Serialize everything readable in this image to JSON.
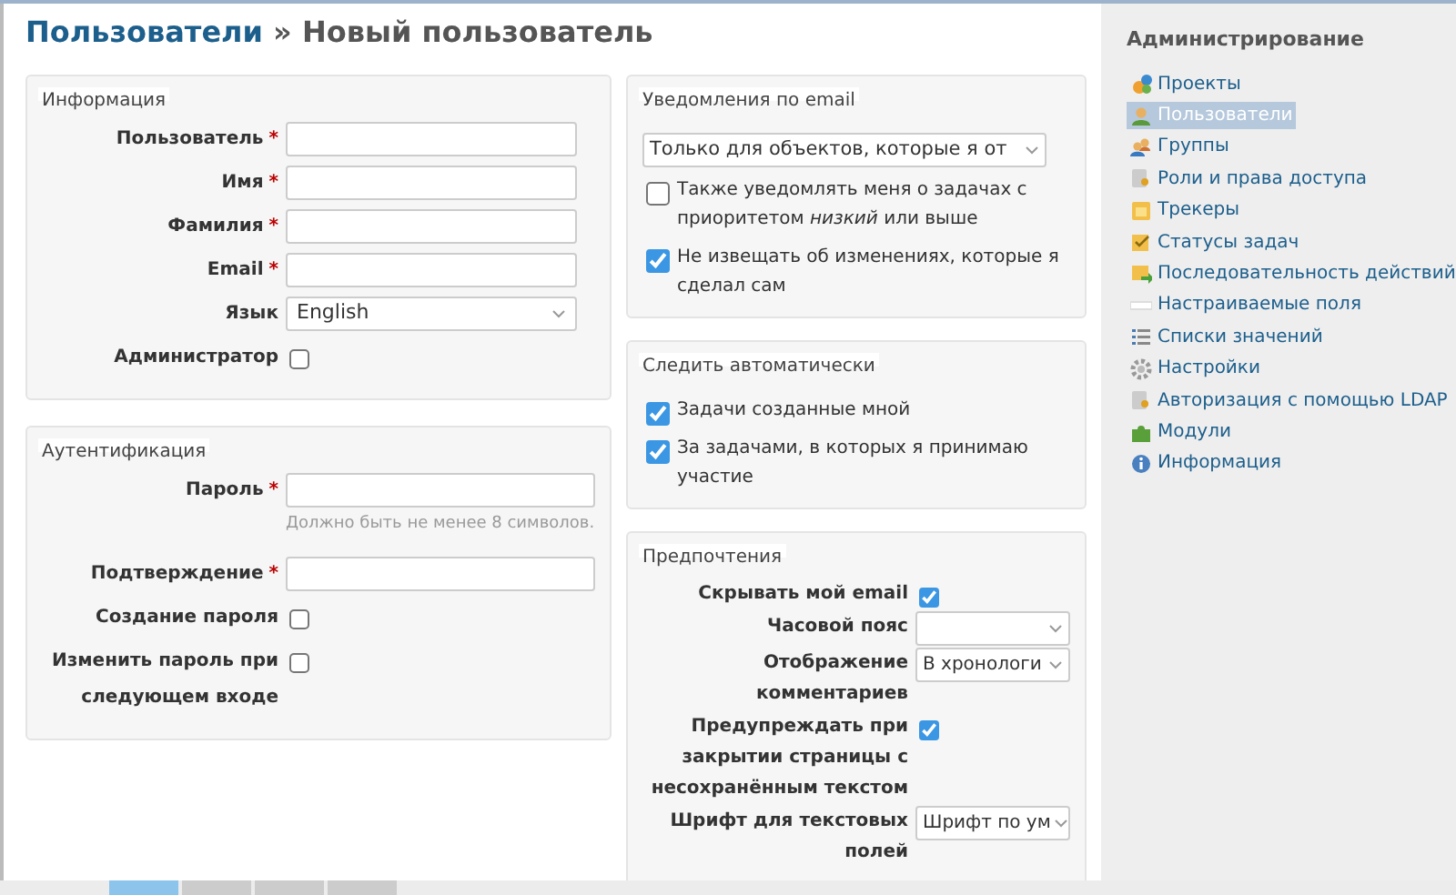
{
  "page_title": {
    "parent": "Пользователи",
    "separator": "»",
    "current": "Новый пользователь"
  },
  "information": {
    "legend": "Информация",
    "fields": [
      {
        "kind": "text",
        "label": "Пользователь",
        "required_mark": "*"
      },
      {
        "kind": "text",
        "label": "Имя",
        "required_mark": "*"
      },
      {
        "kind": "text",
        "label": "Фамилия",
        "required_mark": "*"
      },
      {
        "kind": "text",
        "label": "Email",
        "required_mark": "*"
      },
      {
        "kind": "select",
        "label": "Язык",
        "value": "English"
      },
      {
        "kind": "checkbox",
        "label": "Администратор",
        "checked": false
      }
    ]
  },
  "authentication": {
    "legend": "Аутентификация",
    "fields": [
      {
        "kind": "text",
        "label": "Пароль",
        "required_mark": "*",
        "hint": "Должно быть не менее 8 символов."
      },
      {
        "kind": "text",
        "label": "Подтверждение",
        "required_mark": "*"
      },
      {
        "kind": "checkbox",
        "label": "Создание пароля",
        "checked": false
      },
      {
        "kind": "checkbox",
        "label": "Изменить пароль при следующем входе",
        "checked": false
      }
    ]
  },
  "email_notifications": {
    "legend": "Уведомления по email",
    "select_value": "Только для объектов, которые я от",
    "options": [
      {
        "text": "Также уведомлять меня о задачах с приоритетом *низкий* или выше",
        "checked": false
      },
      {
        "text": "Не извещать об изменениях, которые я сделал сам",
        "checked": true
      }
    ]
  },
  "auto_watch": {
    "legend": "Следить автоматически",
    "options": [
      {
        "text": "Задачи созданные мной",
        "checked": true
      },
      {
        "text": "За задачами, в которых я принимаю участие",
        "checked": true
      }
    ]
  },
  "preferences": {
    "legend": "Предпочтения",
    "fields": [
      {
        "kind": "checkbox",
        "label": "Скрывать мой email",
        "checked": true
      },
      {
        "kind": "select",
        "label": "Часовой пояс"
      },
      {
        "kind": "select",
        "label": "Отображение комментариев",
        "value": "В хронологи"
      },
      {
        "kind": "checkbox",
        "label": "Предупреждать при закрытии страницы с несохранённым текстом",
        "checked": true
      },
      {
        "kind": "select",
        "label": "Шрифт для текстовых полей",
        "value": "Шрифт по ум"
      }
    ]
  },
  "sidebar": {
    "title": "Администрирование",
    "items": [
      {
        "label": "Проекты",
        "selected": false
      },
      {
        "label": "Пользователи",
        "selected": true
      },
      {
        "label": "Группы",
        "selected": false
      },
      {
        "label": "Роли и права доступа",
        "selected": false
      },
      {
        "label": "Трекеры",
        "selected": false
      },
      {
        "label": "Статусы задач",
        "selected": false
      },
      {
        "label": "Последовательность действий",
        "selected": false
      },
      {
        "label": "Настраиваемые поля",
        "selected": false
      },
      {
        "label": "Списки значений",
        "selected": false
      },
      {
        "label": "Настройки",
        "selected": false
      },
      {
        "label": "Авторизация с помощью LDAP",
        "selected": false
      },
      {
        "label": "Модули",
        "selected": false
      },
      {
        "label": "Информация",
        "selected": false
      }
    ]
  }
}
